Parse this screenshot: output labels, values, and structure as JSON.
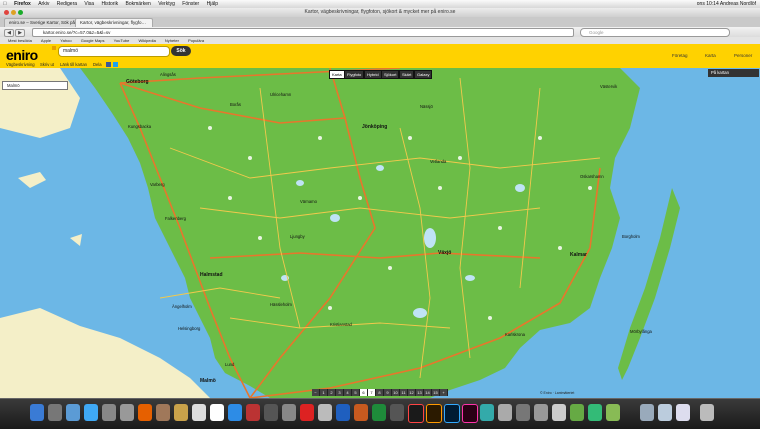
{
  "menubar": {
    "items": [
      "Firefox",
      "Arkiv",
      "Redigera",
      "Visa",
      "Historik",
      "Bokmärken",
      "Verktyg",
      "Fönster",
      "Hjälp"
    ],
    "right": "ons 10:14   Andreas Nordlöf"
  },
  "window": {
    "title": "Kartor, vägbeskrivningar, flygfoton, sjökort & mycket mer på eniro.se"
  },
  "tabs": [
    {
      "label": "eniro.se – Sverige Kartor, Sök på Eniro"
    },
    {
      "label": "Kartor, vägbeskrivningar, flygfo…"
    }
  ],
  "navbar": {
    "url": "kartor.eniro.se/?c=57.0&z=5&l=sv",
    "search_placeholder": "Google"
  },
  "bookmarks": [
    "Mest besökta",
    "Apple",
    "Yahoo",
    "Google Maps",
    "YouTube",
    "Wikipedia",
    "Nyheter",
    "Populära"
  ],
  "header": {
    "logo": "eniro",
    "search_value": "malmö",
    "search_button": "Sök",
    "links": [
      "Företag",
      "Karta",
      "Personer"
    ]
  },
  "subnav": {
    "items": [
      "Vägbeskrivning",
      "Skriv ut",
      "Länk till kartan",
      "Dela"
    ]
  },
  "map_types": [
    "Karta",
    "Flygfoto",
    "Hybrid",
    "Sjökort",
    "Skärt",
    "Galaxy"
  ],
  "map_type_active": "Karta",
  "pa_kartan": "På kartan",
  "result_box": "Malmö",
  "zoom_levels": [
    "1",
    "2",
    "3",
    "4",
    "5",
    "6",
    "7",
    "8",
    "9",
    "10",
    "11",
    "12",
    "13",
    "14",
    "15"
  ],
  "zoom_active": "7",
  "copyright": "© Eniro · Lantmäteriet",
  "places": [
    {
      "name": "Göteborg",
      "big": true
    },
    {
      "name": "Borås"
    },
    {
      "name": "Jönköping",
      "big": true
    },
    {
      "name": "Växjö",
      "big": true
    },
    {
      "name": "Halmstad",
      "big": true
    },
    {
      "name": "Helsingborg"
    },
    {
      "name": "Malmö",
      "big": true
    },
    {
      "name": "Kristianstad"
    },
    {
      "name": "Kalmar",
      "big": true
    },
    {
      "name": "Karlskrona"
    },
    {
      "name": "Västervik"
    },
    {
      "name": "Varberg"
    },
    {
      "name": "Falkenberg"
    },
    {
      "name": "Värnamo"
    },
    {
      "name": "Ljungby"
    },
    {
      "name": "Vetlanda"
    },
    {
      "name": "Nässjö"
    },
    {
      "name": "Ulricehamn"
    },
    {
      "name": "Alingsås"
    },
    {
      "name": "Kungsbacka"
    },
    {
      "name": "Hässleholm"
    },
    {
      "name": "Ängelholm"
    },
    {
      "name": "Borgholm"
    },
    {
      "name": "Oskarshamn"
    },
    {
      "name": "Mörbylånga"
    },
    {
      "name": "Lund"
    }
  ],
  "colors": {
    "land": "#6cbd47",
    "water": "#6cb7e6",
    "brand": "#ffd200",
    "road_major": "#e8762c",
    "road_minor": "#f2c94c"
  }
}
